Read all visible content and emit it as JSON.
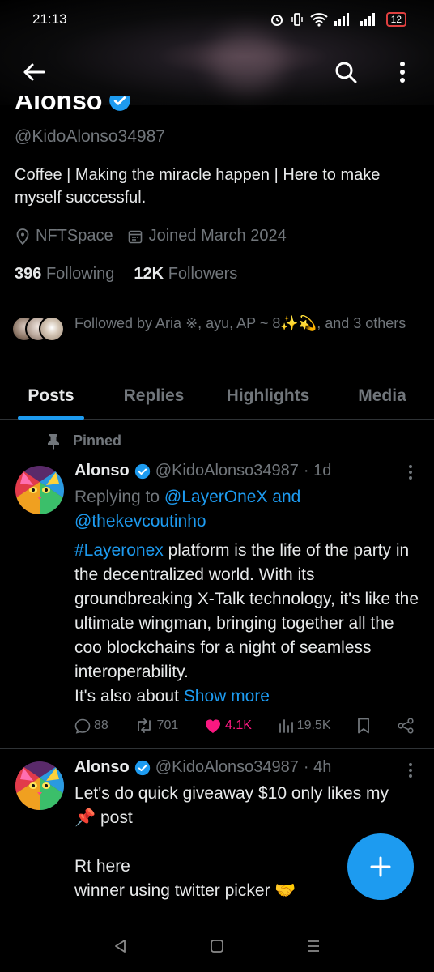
{
  "status_bar": {
    "time": "21:13",
    "battery": "12",
    "icons": [
      "alarm-icon",
      "vibrate-icon",
      "wifi-icon",
      "signal-icon",
      "signal-icon",
      "battery-icon"
    ]
  },
  "header": {
    "back_icon": "arrow-left-icon",
    "search_icon": "search-icon",
    "more_icon": "more-vertical-icon"
  },
  "profile": {
    "name": "Alonso",
    "verified": true,
    "handle": "@KidoAlonso34987",
    "bio": "Coffee | Making the miracle happen | Here to make myself successful.",
    "location": "NFTSpace",
    "joined": "Joined March 2024",
    "following_count": "396",
    "following_label": "Following",
    "followers_count": "12K",
    "followers_label": "Followers",
    "followed_by": "Followed by Aria ※, ayu, AP ~ 8✨💫, and 3 others"
  },
  "tabs": [
    {
      "label": "Posts",
      "active": true
    },
    {
      "label": "Replies",
      "active": false
    },
    {
      "label": "Highlights",
      "active": false
    },
    {
      "label": "Media",
      "active": false
    }
  ],
  "posts": [
    {
      "pinned_label": "Pinned",
      "name": "Alonso",
      "handle": "@KidoAlonso34987",
      "time": "· 1d",
      "replying_prefix": "Replying to",
      "replying_to_1": "@LayerOneX and",
      "replying_to_2": "@thekevcoutinho",
      "hashtag": "#Layeronex",
      "text": "platform is the life of the party in the decentralized world. With its groundbreaking X-Talk technology, it's like the ultimate wingman, bringing together all the coo blockchains for a night of seamless interoperability.",
      "text_tail": "It's also about",
      "show_more": "Show more",
      "replies": "88",
      "reposts": "701",
      "likes": "4.1K",
      "views": "19.5K"
    },
    {
      "name": "Alonso",
      "handle": "@KidoAlonso34987",
      "time": "· 4h",
      "line1": "Let's do quick giveaway $10 only likes my",
      "line2": "📌 post",
      "line3": "Rt here",
      "line4": "winner using twitter picker 🤝"
    }
  ],
  "colors": {
    "accent": "#1d9bf0",
    "like": "#f91880",
    "muted": "#71767b",
    "text": "#e7e9ea",
    "background": "#000000"
  }
}
